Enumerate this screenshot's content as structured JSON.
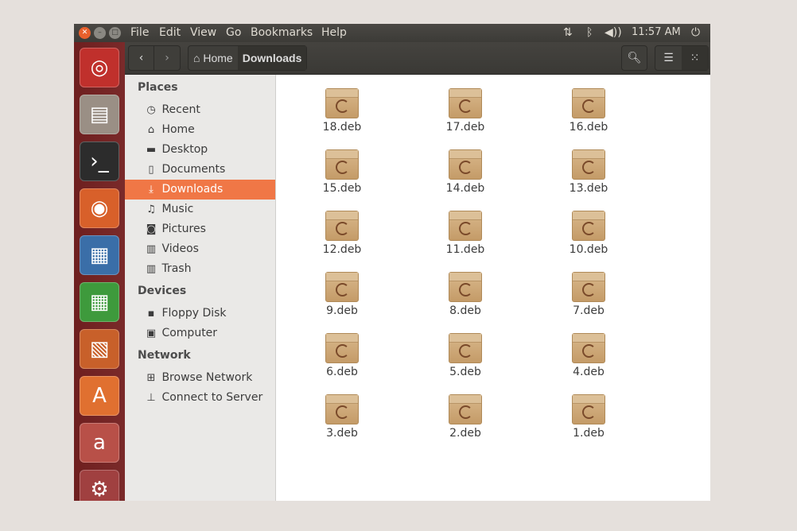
{
  "menubar": {
    "items": [
      "File",
      "Edit",
      "View",
      "Go",
      "Bookmarks",
      "Help"
    ],
    "clock": "11:57 AM"
  },
  "toolbar": {
    "breadcrumb": [
      {
        "label": "Home",
        "icon": "home-icon"
      },
      {
        "label": "Downloads"
      }
    ]
  },
  "launcher": [
    {
      "name": "ubuntu-dash",
      "color": "#c0302c"
    },
    {
      "name": "files",
      "color": "#9a8f85"
    },
    {
      "name": "terminal",
      "color": "#2c2c2c"
    },
    {
      "name": "firefox",
      "color": "#d8602a"
    },
    {
      "name": "libreoffice-writer",
      "color": "#3a6ea8"
    },
    {
      "name": "libreoffice-calc",
      "color": "#3e9a3c"
    },
    {
      "name": "libreoffice-impress",
      "color": "#c8602a"
    },
    {
      "name": "software-center",
      "color": "#e07030"
    },
    {
      "name": "amazon",
      "color": "#b85048"
    },
    {
      "name": "system-settings",
      "color": "#a04040"
    }
  ],
  "sidebar": {
    "places_label": "Places",
    "places": [
      {
        "label": "Recent",
        "icon": "clock-icon"
      },
      {
        "label": "Home",
        "icon": "home-icon"
      },
      {
        "label": "Desktop",
        "icon": "folder-icon"
      },
      {
        "label": "Documents",
        "icon": "document-icon"
      },
      {
        "label": "Downloads",
        "icon": "download-icon",
        "active": true
      },
      {
        "label": "Music",
        "icon": "music-icon"
      },
      {
        "label": "Pictures",
        "icon": "camera-icon"
      },
      {
        "label": "Videos",
        "icon": "film-icon"
      },
      {
        "label": "Trash",
        "icon": "trash-icon"
      }
    ],
    "devices_label": "Devices",
    "devices": [
      {
        "label": "Floppy Disk",
        "icon": "floppy-icon"
      },
      {
        "label": "Computer",
        "icon": "computer-icon"
      }
    ],
    "network_label": "Network",
    "network": [
      {
        "label": "Browse Network",
        "icon": "network-icon"
      },
      {
        "label": "Connect to Server",
        "icon": "server-icon"
      }
    ]
  },
  "files": [
    "18.deb",
    "17.deb",
    "16.deb",
    "15.deb",
    "14.deb",
    "13.deb",
    "12.deb",
    "11.deb",
    "10.deb",
    "9.deb",
    "8.deb",
    "7.deb",
    "6.deb",
    "5.deb",
    "4.deb",
    "3.deb",
    "2.deb",
    "1.deb"
  ],
  "accent": "#f07746"
}
